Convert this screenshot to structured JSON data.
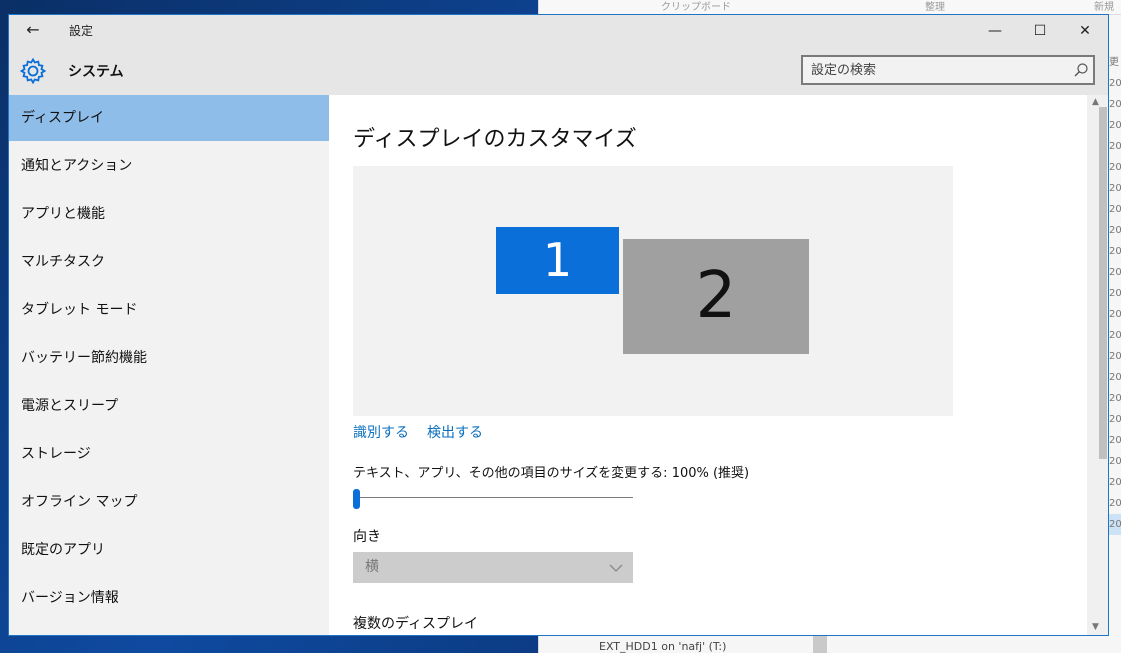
{
  "background_window": {
    "ribbon_labels": [
      "クリップボード",
      "整理",
      "新規"
    ],
    "side_text": "更",
    "year_items": [
      "20",
      "20",
      "20",
      "20",
      "20",
      "20",
      "20",
      "20",
      "20",
      "20",
      "20",
      "20",
      "20",
      "20",
      "20",
      "20",
      "20",
      "20",
      "20",
      "20",
      "20",
      "20"
    ],
    "bottom_item": "EXT_HDD1 on 'nafj' (T:)"
  },
  "titlebar": {
    "back_icon": "←",
    "title": "設定",
    "minimize_icon": "—",
    "maximize_icon": "☐",
    "close_icon": "✕"
  },
  "header": {
    "title": "システム",
    "search_placeholder": "設定の検索"
  },
  "sidebar": {
    "items": [
      {
        "label": "ディスプレイ",
        "active": true
      },
      {
        "label": "通知とアクション"
      },
      {
        "label": "アプリと機能"
      },
      {
        "label": "マルチタスク"
      },
      {
        "label": "タブレット モード"
      },
      {
        "label": "バッテリー節約機能"
      },
      {
        "label": "電源とスリープ"
      },
      {
        "label": "ストレージ"
      },
      {
        "label": "オフライン マップ"
      },
      {
        "label": "既定のアプリ"
      },
      {
        "label": "バージョン情報"
      }
    ]
  },
  "main": {
    "title": "ディスプレイのカスタマイズ",
    "monitors": [
      {
        "label": "1",
        "color": "#0a6fd8"
      },
      {
        "label": "2",
        "color": "#a0a0a0"
      }
    ],
    "identify_link": "識別する",
    "detect_link": "検出する",
    "scale_label": "テキスト、アプリ、その他の項目のサイズを変更する: 100% (推奨)",
    "scale_value_percent": 0,
    "orientation_label": "向き",
    "orientation_value": "横",
    "multiple_displays_label": "複数のディスプレイ"
  },
  "colors": {
    "accent": "#0a6fd8",
    "sidebar_active": "#8fbde9",
    "link": "#0a6fbf"
  }
}
